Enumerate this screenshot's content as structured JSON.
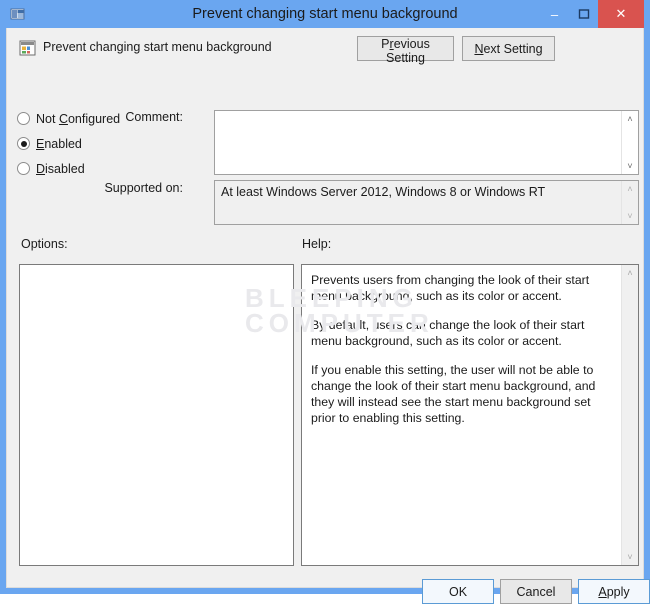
{
  "window": {
    "title": "Prevent changing start menu background",
    "icon": "window-settings-icon",
    "frame_color": "#6aa6f0",
    "caption": {
      "minimize": "–",
      "maximize": "❐",
      "close": "✕",
      "close_color": "#d9534f"
    }
  },
  "header": {
    "policy_name": "Prevent changing start menu background",
    "policy_icon": "policy-setting-icon",
    "previous_setting": {
      "before": "P",
      "accel": "r",
      "after": "evious Setting"
    },
    "next_setting": {
      "before": "",
      "accel": "N",
      "after": "ext Setting"
    }
  },
  "state_options": [
    {
      "before": "Not ",
      "accel": "C",
      "after": "onfigured",
      "checked": false
    },
    {
      "before": "",
      "accel": "E",
      "after": "nabled",
      "checked": true
    },
    {
      "before": "",
      "accel": "D",
      "after": "isabled",
      "checked": false
    }
  ],
  "comment": {
    "label": "Comment:",
    "value": "",
    "scroll_up": "˄",
    "scroll_down": "˅"
  },
  "supported_on": {
    "label": "Supported on:",
    "value": "At least Windows Server 2012, Windows 8 or Windows RT",
    "scroll_up": "˄",
    "scroll_down": "˅"
  },
  "options": {
    "label": "Options:",
    "items": []
  },
  "help": {
    "label": "Help:",
    "paragraphs": [
      "Prevents users from changing the look of their start menu background, such as its color or accent.",
      "By default, users can change the look of their start menu background, such as its color or accent.",
      "If you enable this setting, the user will not be able to change the look of their start menu background, and they will instead see the start menu background set prior to enabling this setting."
    ],
    "scroll_up": "˄",
    "scroll_down": "˅"
  },
  "actions": {
    "ok": "OK",
    "cancel": "Cancel",
    "apply": {
      "before": "",
      "accel": "A",
      "after": "pply"
    }
  },
  "watermark": {
    "line1": "BLEEPING",
    "line2": "COMPUTER"
  }
}
